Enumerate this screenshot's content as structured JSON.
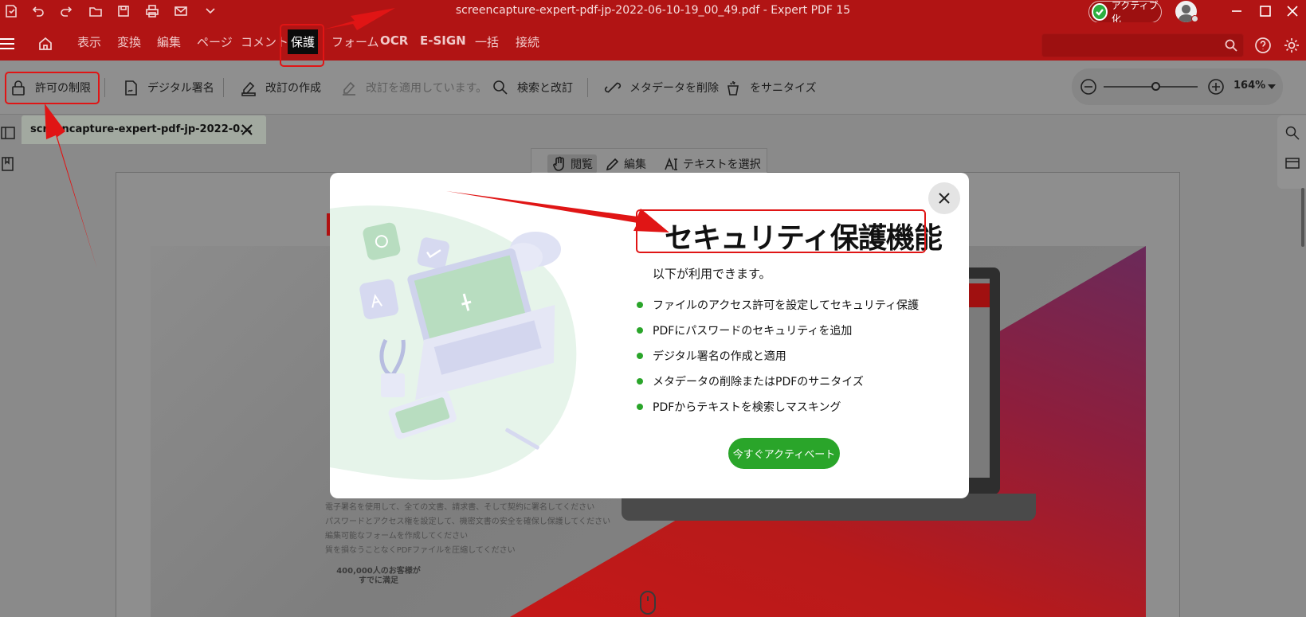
{
  "window": {
    "title": "screencapture-expert-pdf-jp-2022-06-10-19_00_49.pdf   -   Expert PDF 15",
    "activate_label": "アクティブ化"
  },
  "menu": {
    "items": [
      "表示",
      "変換",
      "編集",
      "ページ",
      "コメント",
      "保護",
      "フォーム",
      "OCR",
      "E-SIGN",
      "一括",
      "接続"
    ],
    "active": "保護",
    "search_placeholder": ""
  },
  "toolbar": {
    "restrict": "許可の制限",
    "digital_signature": "デジタル署名",
    "create_redaction": "改訂の作成",
    "apply_redaction": "改訂を適用しています。",
    "search_redact": "検索と改訂",
    "remove_metadata": "メタデータを削除",
    "sanitize": "をサニタイズ",
    "zoom_value": "164%",
    "zoom_fraction": 0.55
  },
  "document": {
    "tab_title": "screencapture-expert-pdf-jp-2022-0...",
    "modes": [
      "閲覧",
      "編集",
      "テキストを選択"
    ],
    "bg_lines": [
      "電子署名を使用して、全ての文書、請求書、そして契約に署名してください",
      "パスワードとアクセス権を設定して、機密文書の安全を確保し保護してください",
      "編集可能なフォームを作成してください",
      "質を損なうことなくPDFファイルを圧縮してください"
    ],
    "customers_badge_line1": "400,000人のお客様が",
    "customers_badge_line2": "すでに満足"
  },
  "modal": {
    "title": "セキュリティ保護機能",
    "subtitle": "以下が利用できます。",
    "features": [
      "ファイルのアクセス許可を設定してセキュリティ保護",
      "PDFにパスワードのセキュリティを追加",
      "デジタル署名の作成と適用",
      "メタデータの削除またはPDFのサニタイズ",
      "PDFからテキストを検索しマスキング"
    ],
    "cta": "今すぐアクティベート"
  },
  "colors": {
    "brand_red": "#b11414",
    "accent_green": "#2aa52a",
    "annotation_red": "#e01515"
  }
}
